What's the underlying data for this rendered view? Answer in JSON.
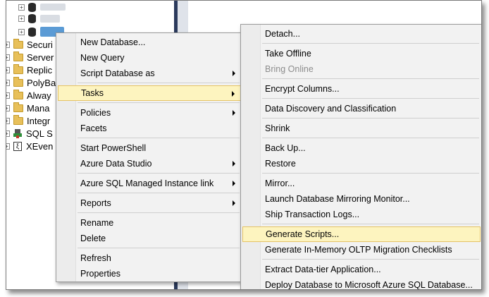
{
  "tree": {
    "items": [
      {
        "label": "Securi",
        "icon": "folder-icon"
      },
      {
        "label": "Server",
        "icon": "folder-icon"
      },
      {
        "label": "Replic",
        "icon": "folder-icon"
      },
      {
        "label": "PolyBa",
        "icon": "folder-icon"
      },
      {
        "label": "Alway",
        "icon": "folder-icon"
      },
      {
        "label": "Mana",
        "icon": "folder-icon"
      },
      {
        "label": "Integr",
        "icon": "folder-icon"
      },
      {
        "label": "SQL S",
        "icon": "sql-agent-icon"
      },
      {
        "label": "XEven",
        "icon": "xevent-icon"
      }
    ]
  },
  "context_menu": {
    "items": [
      {
        "label": "New Database..."
      },
      {
        "label": "New Query"
      },
      {
        "label": "Script Database as"
      },
      {
        "label": "Tasks"
      },
      {
        "label": "Policies"
      },
      {
        "label": "Facets"
      },
      {
        "label": "Start PowerShell"
      },
      {
        "label": "Azure Data Studio"
      },
      {
        "label": "Azure SQL Managed Instance link"
      },
      {
        "label": "Reports"
      },
      {
        "label": "Rename"
      },
      {
        "label": "Delete"
      },
      {
        "label": "Refresh"
      },
      {
        "label": "Properties"
      }
    ]
  },
  "tasks_submenu": {
    "items": [
      {
        "label": "Detach..."
      },
      {
        "label": "Take Offline"
      },
      {
        "label": "Bring Online"
      },
      {
        "label": "Encrypt Columns..."
      },
      {
        "label": "Data Discovery and Classification"
      },
      {
        "label": "Shrink"
      },
      {
        "label": "Back Up..."
      },
      {
        "label": "Restore"
      },
      {
        "label": "Mirror..."
      },
      {
        "label": "Launch Database Mirroring Monitor..."
      },
      {
        "label": "Ship Transaction Logs..."
      },
      {
        "label": "Generate Scripts..."
      },
      {
        "label": "Generate In-Memory OLTP Migration Checklists"
      },
      {
        "label": "Extract Data-tier Application..."
      },
      {
        "label": "Deploy Database to Microsoft Azure SQL Database..."
      }
    ]
  },
  "colors": {
    "highlight_bg": "#fdf4bf",
    "highlight_border": "#e5c365",
    "menu_bg": "#f2f2f2",
    "folder": "#e8c05a"
  }
}
